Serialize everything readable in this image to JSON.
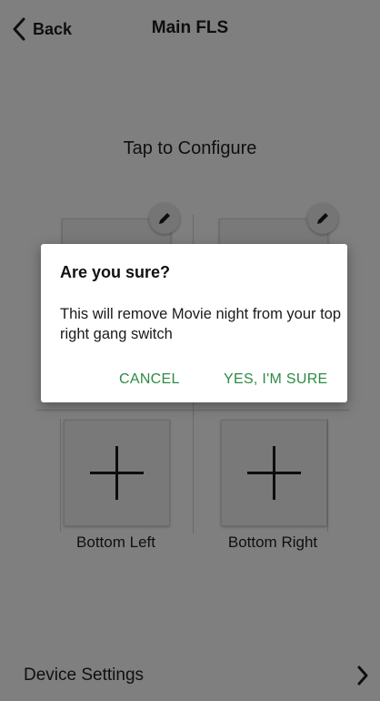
{
  "header": {
    "back_label": "Back",
    "title": "Main FLS"
  },
  "main": {
    "subtitle": "Tap to Configure",
    "gangs": {
      "bottom_left_label": "Bottom Left",
      "bottom_right_label": "Bottom Right"
    }
  },
  "footer": {
    "device_settings_label": "Device Settings"
  },
  "dialog": {
    "title": "Are you sure?",
    "message": "This will remove Movie night from your top right gang switch",
    "cancel_label": "CANCEL",
    "confirm_label": "YES, I'M SURE"
  },
  "icons": {
    "back": "chevron-left-icon",
    "edit": "pencil-icon",
    "add": "plus-icon",
    "forward": "chevron-right-icon"
  },
  "colors": {
    "accent": "#2e8a45",
    "scrim": "#000000"
  }
}
